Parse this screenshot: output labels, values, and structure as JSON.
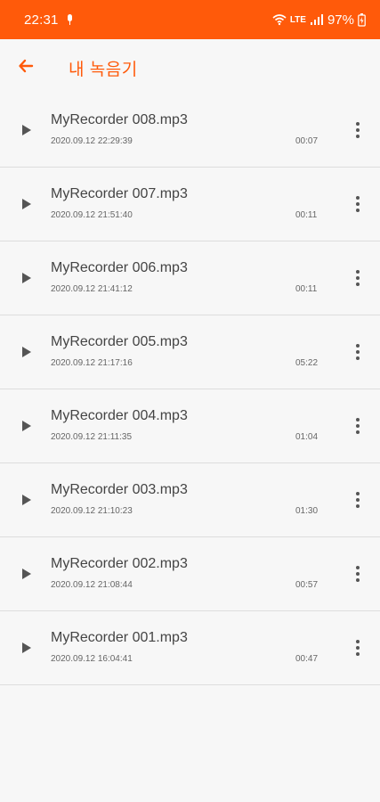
{
  "status_bar": {
    "time": "22:31",
    "network_label": "LTE",
    "battery_percent": "97%",
    "icons": [
      "mic-icon",
      "wifi-icon",
      "signal-icon",
      "battery-icon"
    ]
  },
  "header": {
    "title": "내 녹음기",
    "back_icon": "arrow-left-icon"
  },
  "recordings": [
    {
      "name": "MyRecorder 008.mp3",
      "date": "2020.09.12 22:29:39",
      "duration": "00:07"
    },
    {
      "name": "MyRecorder 007.mp3",
      "date": "2020.09.12 21:51:40",
      "duration": "00:11"
    },
    {
      "name": "MyRecorder 006.mp3",
      "date": "2020.09.12 21:41:12",
      "duration": "00:11"
    },
    {
      "name": "MyRecorder 005.mp3",
      "date": "2020.09.12 21:17:16",
      "duration": "05:22"
    },
    {
      "name": "MyRecorder 004.mp3",
      "date": "2020.09.12 21:11:35",
      "duration": "01:04"
    },
    {
      "name": "MyRecorder 003.mp3",
      "date": "2020.09.12 21:10:23",
      "duration": "01:30"
    },
    {
      "name": "MyRecorder 002.mp3",
      "date": "2020.09.12 21:08:44",
      "duration": "00:57"
    },
    {
      "name": "MyRecorder 001.mp3",
      "date": "2020.09.12 16:04:41",
      "duration": "00:47"
    }
  ],
  "colors": {
    "accent": "#ff5a0a",
    "background": "#f7f7f7",
    "divider": "#dddddd",
    "text_primary": "#444444",
    "text_secondary": "#666666"
  }
}
